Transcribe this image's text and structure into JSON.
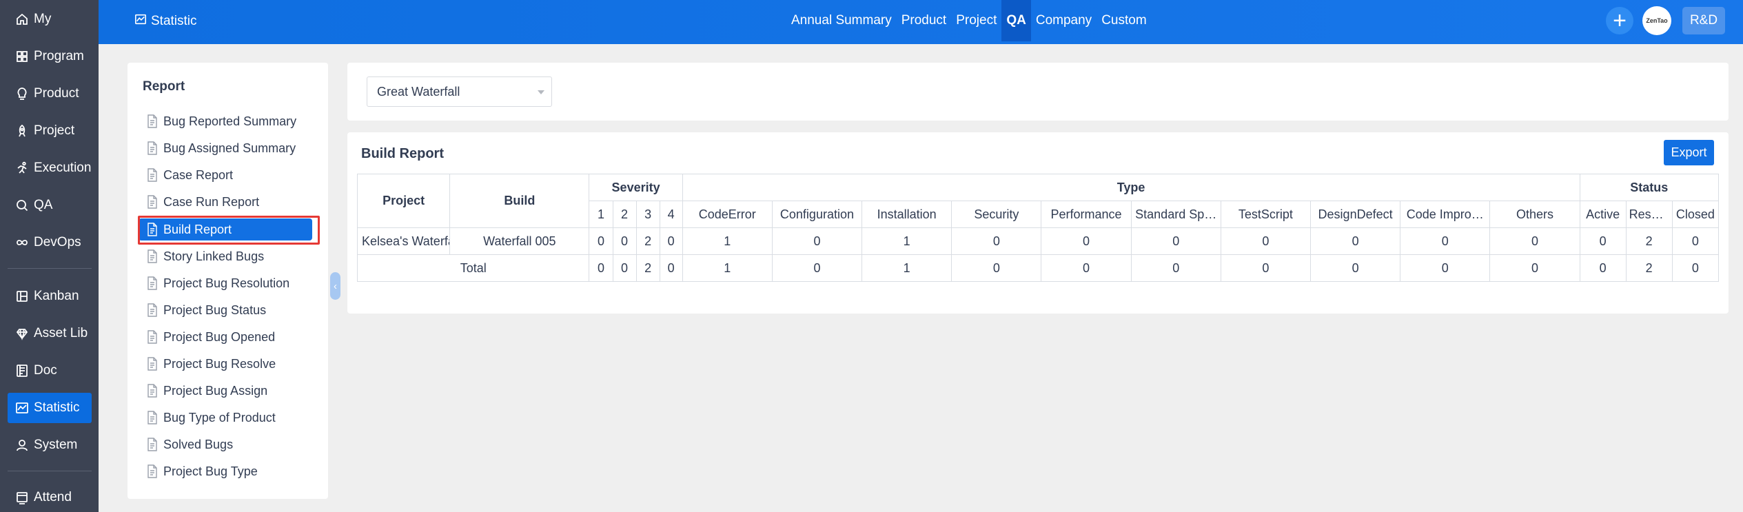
{
  "sidebar": {
    "items": [
      {
        "label": "My",
        "icon": "home-icon"
      },
      {
        "label": "Program",
        "icon": "grid-icon"
      },
      {
        "label": "Product",
        "icon": "lightbulb-icon"
      },
      {
        "label": "Project",
        "icon": "rocket-icon"
      },
      {
        "label": "Execution",
        "icon": "run-icon"
      },
      {
        "label": "QA",
        "icon": "search-icon"
      },
      {
        "label": "DevOps",
        "icon": "infinity-icon"
      },
      {
        "label": "Kanban",
        "icon": "kanban-icon"
      },
      {
        "label": "Asset Lib",
        "icon": "diamond-icon"
      },
      {
        "label": "Doc",
        "icon": "doc-icon"
      },
      {
        "label": "Statistic",
        "icon": "chart-icon"
      },
      {
        "label": "System",
        "icon": "user-icon"
      },
      {
        "label": "Attend",
        "icon": "attend-icon"
      }
    ],
    "active": "Statistic"
  },
  "header": {
    "title": "Statistic",
    "nav": [
      "Annual Summary",
      "Product",
      "Project",
      "QA",
      "Company",
      "Custom"
    ],
    "active_nav": "QA",
    "avatar_text": "ZenTao",
    "dept_button": "R&D"
  },
  "report_menu": {
    "title": "Report",
    "items": [
      "Bug Reported Summary",
      "Bug Assigned Summary",
      "Case Report",
      "Case Run Report",
      "Build Report",
      "Story Linked Bugs",
      "Project Bug Resolution",
      "Project Bug Status",
      "Project Bug Opened",
      "Project Bug Resolve",
      "Project Bug Assign",
      "Bug Type of Product",
      "Solved Bugs",
      "Project Bug Type"
    ],
    "active": "Build Report"
  },
  "filter": {
    "project_select": "Great Waterfall"
  },
  "build_report": {
    "title": "Build Report",
    "export_label": "Export",
    "headers": {
      "project": "Project",
      "build": "Build",
      "severity": "Severity",
      "type": "Type",
      "status": "Status",
      "severity_cols": [
        "1",
        "2",
        "3",
        "4"
      ],
      "type_cols": [
        "CodeError",
        "Configuration",
        "Installation",
        "Security",
        "Performance",
        "Standard Sp…",
        "TestScript",
        "DesignDefect",
        "Code Impro…",
        "Others"
      ],
      "status_cols": [
        "Active",
        "Resolve",
        "Closed"
      ]
    },
    "rows": [
      {
        "project": "Kelsea's Waterfa",
        "build": "Waterfall 005",
        "values": [
          "0",
          "0",
          "2",
          "0",
          "1",
          "0",
          "1",
          "0",
          "0",
          "0",
          "0",
          "0",
          "0",
          "0",
          "0",
          "2",
          "0"
        ]
      }
    ],
    "total": {
      "label": "Total",
      "values": [
        "0",
        "0",
        "2",
        "0",
        "1",
        "0",
        "1",
        "0",
        "0",
        "0",
        "0",
        "0",
        "0",
        "0",
        "0",
        "2",
        "0"
      ]
    }
  }
}
